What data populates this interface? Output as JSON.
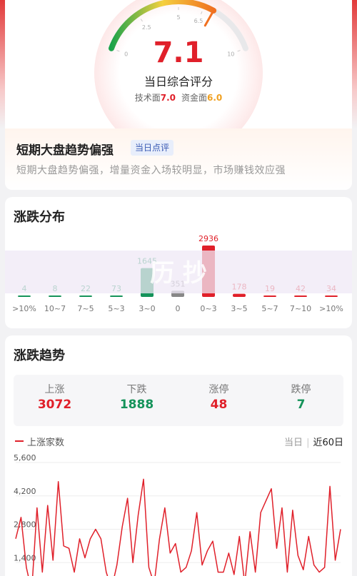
{
  "gauge": {
    "score": "7.1",
    "label": "当日综合评分",
    "tick_labels": [
      "0",
      "2.5",
      "5",
      "6.5",
      "10"
    ],
    "level": 0.71,
    "technical_label": "技术面",
    "technical_value": "7.0",
    "capital_label": "资金面",
    "capital_value": "6.0"
  },
  "comment": {
    "title": "短期大盘趋势偏强",
    "tag": "当日点评",
    "text": "短期大盘趋势偏强，增量资金入场较明显，市场赚钱效应强"
  },
  "distribution": {
    "title": "涨跌分布",
    "overlay_text": "历 抄",
    "colors": {
      "down": "#15935a",
      "flat": "#888888",
      "up": "#e0202a"
    },
    "chart_data": {
      "type": "bar",
      "categories": [
        ">10%",
        "10~7",
        "7~5",
        "5~3",
        "3~0",
        "0",
        "0~3",
        "3~5",
        "5~7",
        "7~10",
        ">10%"
      ],
      "display_categories": [
        ">10%",
        "10~7",
        "7~5",
        "5~3",
        "3~0",
        "0",
        "0~3",
        "3~5",
        "5~7",
        "7~10",
        ">10%"
      ],
      "values": [
        4,
        8,
        22,
        73,
        1645,
        351,
        2936,
        178,
        19,
        42,
        34
      ],
      "value_labels": [
        "4",
        "8",
        "22",
        "73",
        "1645",
        "351",
        "2936",
        "178",
        "19",
        "42",
        "34"
      ],
      "groups": [
        "down",
        "down",
        "down",
        "down",
        "down",
        "flat",
        "up",
        "up",
        "up",
        "up",
        "up"
      ]
    }
  },
  "trend": {
    "title": "涨跌趋势",
    "stats": [
      {
        "label": "上涨",
        "value": "3072",
        "color": "red"
      },
      {
        "label": "下跌",
        "value": "1888",
        "color": "green"
      },
      {
        "label": "涨停",
        "value": "48",
        "color": "red"
      },
      {
        "label": "跌停",
        "value": "7",
        "color": "green"
      }
    ],
    "legend_label": "上涨家数",
    "range_options": [
      "当日",
      "近60日"
    ],
    "range_selected": "近60日",
    "chart_data": {
      "type": "line",
      "series": [
        {
          "name": "上涨家数",
          "color": "#e0202a",
          "values": [
            2400,
            3300,
            1200,
            200,
            3700,
            1000,
            3800,
            1500,
            4800,
            2100,
            2000,
            1000,
            2400,
            1600,
            2400,
            2800,
            2400,
            1000,
            300,
            1300,
            2900,
            4100,
            1400,
            3400,
            4900,
            1200,
            500,
            2400,
            3700,
            1800,
            2200,
            1000,
            1200,
            1900,
            3500,
            1300,
            1900,
            2300,
            1000,
            1000,
            1800,
            900,
            2500,
            500,
            2700,
            1000,
            3500,
            4000,
            4500,
            2000,
            3700,
            1000,
            3600,
            1700,
            1100,
            2500,
            1300,
            1000,
            1200,
            4600,
            1500,
            2800
          ]
        }
      ],
      "ylim": [
        0,
        5600
      ],
      "yticks": [
        "5,600",
        "4,200",
        "2,800",
        "1,400"
      ],
      "ytick_values": [
        5600,
        4200,
        2800,
        1400
      ]
    }
  }
}
